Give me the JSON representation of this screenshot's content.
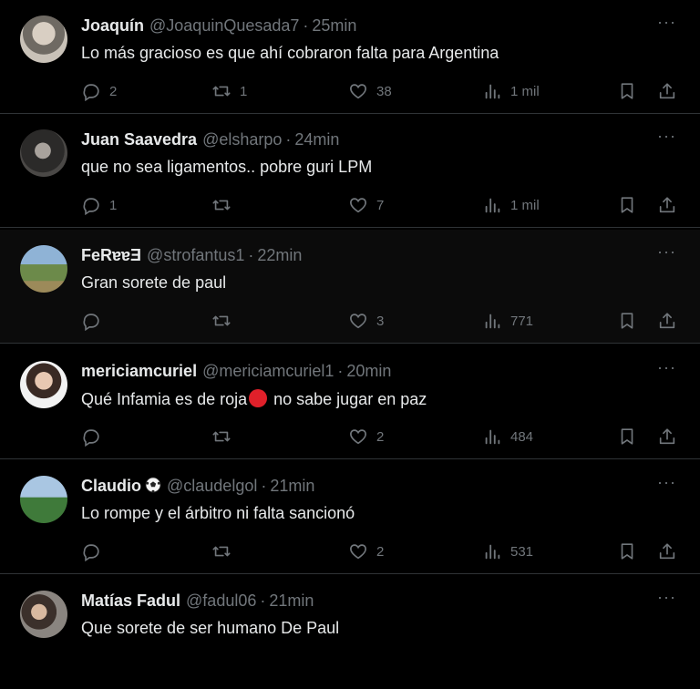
{
  "tweets": [
    {
      "name": "Joaquín",
      "handle": "@JoaquinQuesada7",
      "time": "25min",
      "text": "Lo más gracioso es que ahí cobraron falta para Argentina",
      "replies": "2",
      "retweets": "1",
      "likes": "38",
      "views": "1 mil"
    },
    {
      "name": "Juan Saavedra",
      "handle": "@elsharpo",
      "time": "24min",
      "text": "que no sea ligamentos.. pobre guri LPM",
      "replies": "1",
      "retweets": "",
      "likes": "7",
      "views": "1 mil"
    },
    {
      "name": "FeRɐɐƎ",
      "handle": "@strofantus1",
      "time": "22min",
      "text": "Gran sorete de paul",
      "replies": "",
      "retweets": "",
      "likes": "3",
      "views": "771"
    },
    {
      "name": "mericiamcuriel",
      "handle": "@mericiamcuriel1",
      "time": "20min",
      "text_before": "Qué Infamia es de roja",
      "text_after": " no sabe jugar en paz",
      "replies": "",
      "retweets": "",
      "likes": "2",
      "views": "484"
    },
    {
      "name": "Claudio",
      "handle": "@claudelgol",
      "time": "21min",
      "text": "Lo rompe y el árbitro ni falta sancionó",
      "replies": "",
      "retweets": "",
      "likes": "2",
      "views": "531"
    },
    {
      "name": "Matías Fadul",
      "handle": "@fadul06",
      "time": "21min",
      "text": "Que sorete de ser humano De Paul"
    }
  ],
  "separator": "·",
  "more_label": "···",
  "icons": {
    "reply": "reply-icon",
    "retweet": "retweet-icon",
    "like": "heart-icon",
    "views": "views-icon",
    "bookmark": "bookmark-icon",
    "share": "share-icon"
  },
  "colors": {
    "background": "#000000",
    "text": "#e7e9ea",
    "muted": "#71767b",
    "border": "#2f3336"
  }
}
